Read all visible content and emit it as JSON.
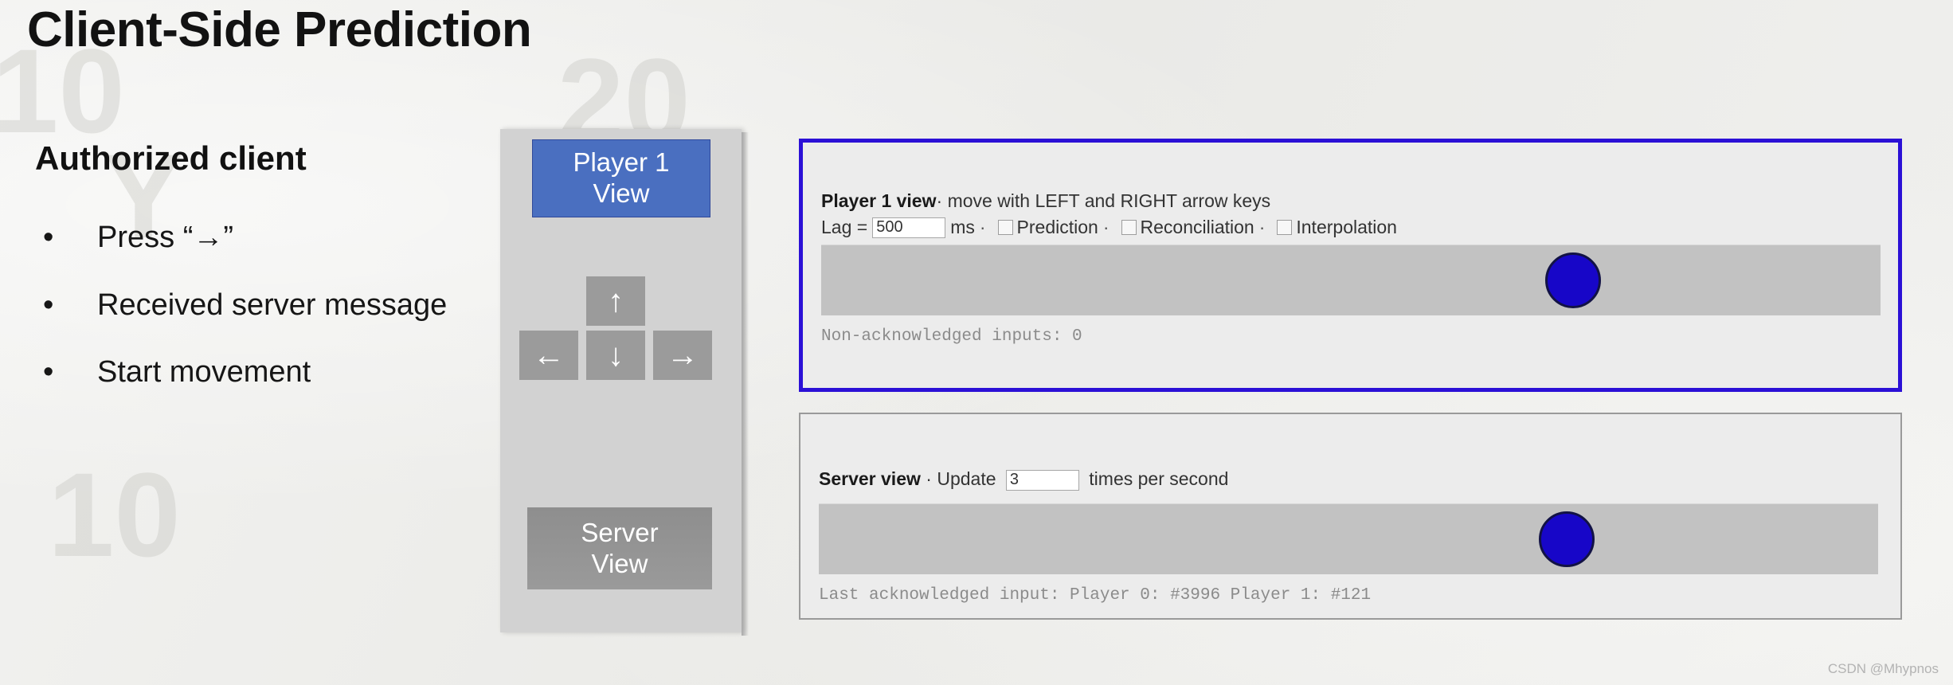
{
  "slide": {
    "title": "Client-Side Prediction",
    "watermark": "CSDN @Mhypnos"
  },
  "left": {
    "heading": "Authorized client",
    "bullets": [
      {
        "marker": "•",
        "text": "Press “→”"
      },
      {
        "marker": "•",
        "text": "Received server message"
      },
      {
        "marker": "•",
        "text": "Start movement"
      }
    ]
  },
  "controls": {
    "player1_button": {
      "line1": "Player 1",
      "line2": "View",
      "color": "#4a6fc0"
    },
    "server_button": {
      "line1": "Server",
      "line2": "View",
      "color": "#9a9a9a"
    },
    "dpad": {
      "up": "↑",
      "left": "←",
      "down": "↓",
      "right": "→"
    }
  },
  "player_view": {
    "title": "Player 1 view",
    "separator": "·",
    "subtitle": "move with LEFT and RIGHT arrow keys",
    "lag_label": "Lag =",
    "lag_value": "500",
    "lag_unit": "ms",
    "options": [
      {
        "label": "Prediction",
        "checked": false
      },
      {
        "label": "Reconciliation",
        "checked": false
      },
      {
        "label": "Interpolation",
        "checked": false
      }
    ],
    "status": "Non-acknowledged inputs: 0",
    "ball_x_pct": 71.0,
    "border_color": "#2b10d6"
  },
  "server_view": {
    "title": "Server view",
    "separator": "·",
    "update_label": "Update",
    "update_value": "3",
    "update_suffix": "times per second",
    "status": "Last acknowledged input: Player 0: #3996 Player 1: #121",
    "ball_x_pct": 70.6,
    "border_color": "#9a9a9a"
  }
}
